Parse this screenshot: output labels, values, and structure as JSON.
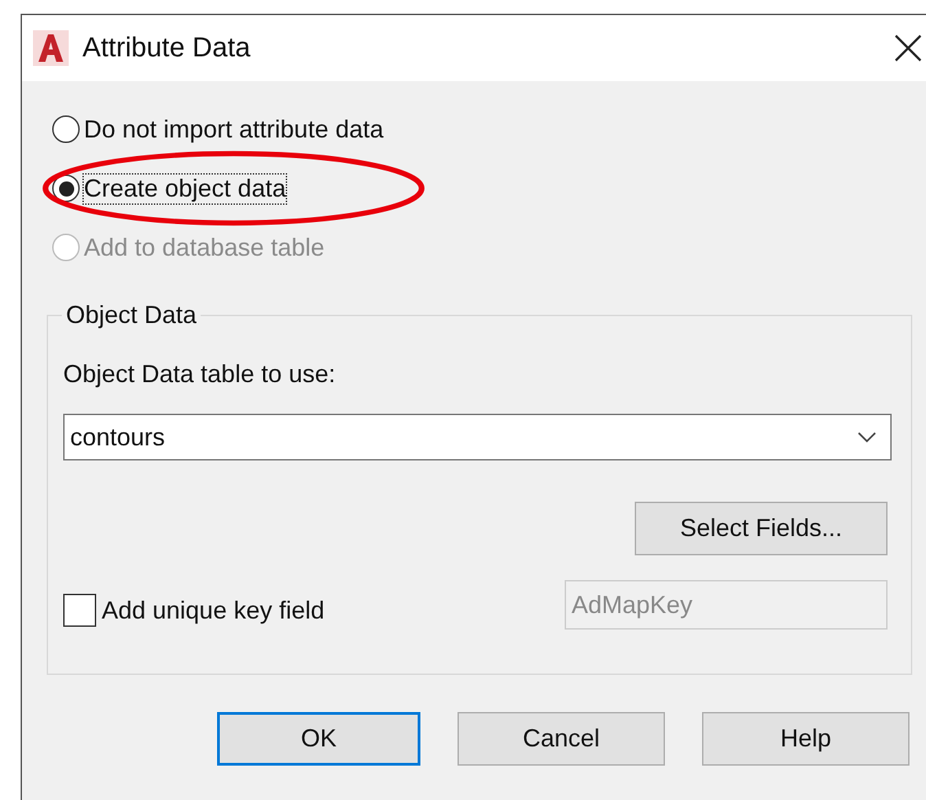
{
  "window": {
    "title": "Attribute Data"
  },
  "options": [
    {
      "label": "Do not import attribute data",
      "selected": false,
      "disabled": false,
      "circled": false
    },
    {
      "label": "Create object data",
      "selected": true,
      "disabled": false,
      "circled": true
    },
    {
      "label": "Add to database table",
      "selected": false,
      "disabled": true,
      "circled": false
    }
  ],
  "object_data": {
    "title": "Object Data",
    "table_label": "Object Data table to use:",
    "table_value": "contours",
    "select_fields_button": "Select Fields...",
    "unique_key": {
      "label": "Add unique key field",
      "checked": false
    },
    "key_field": {
      "value": "AdMapKey",
      "disabled": true
    }
  },
  "buttons": [
    {
      "label": "OK",
      "default": true
    },
    {
      "label": "Cancel",
      "default": false
    },
    {
      "label": "Help",
      "default": false
    }
  ]
}
